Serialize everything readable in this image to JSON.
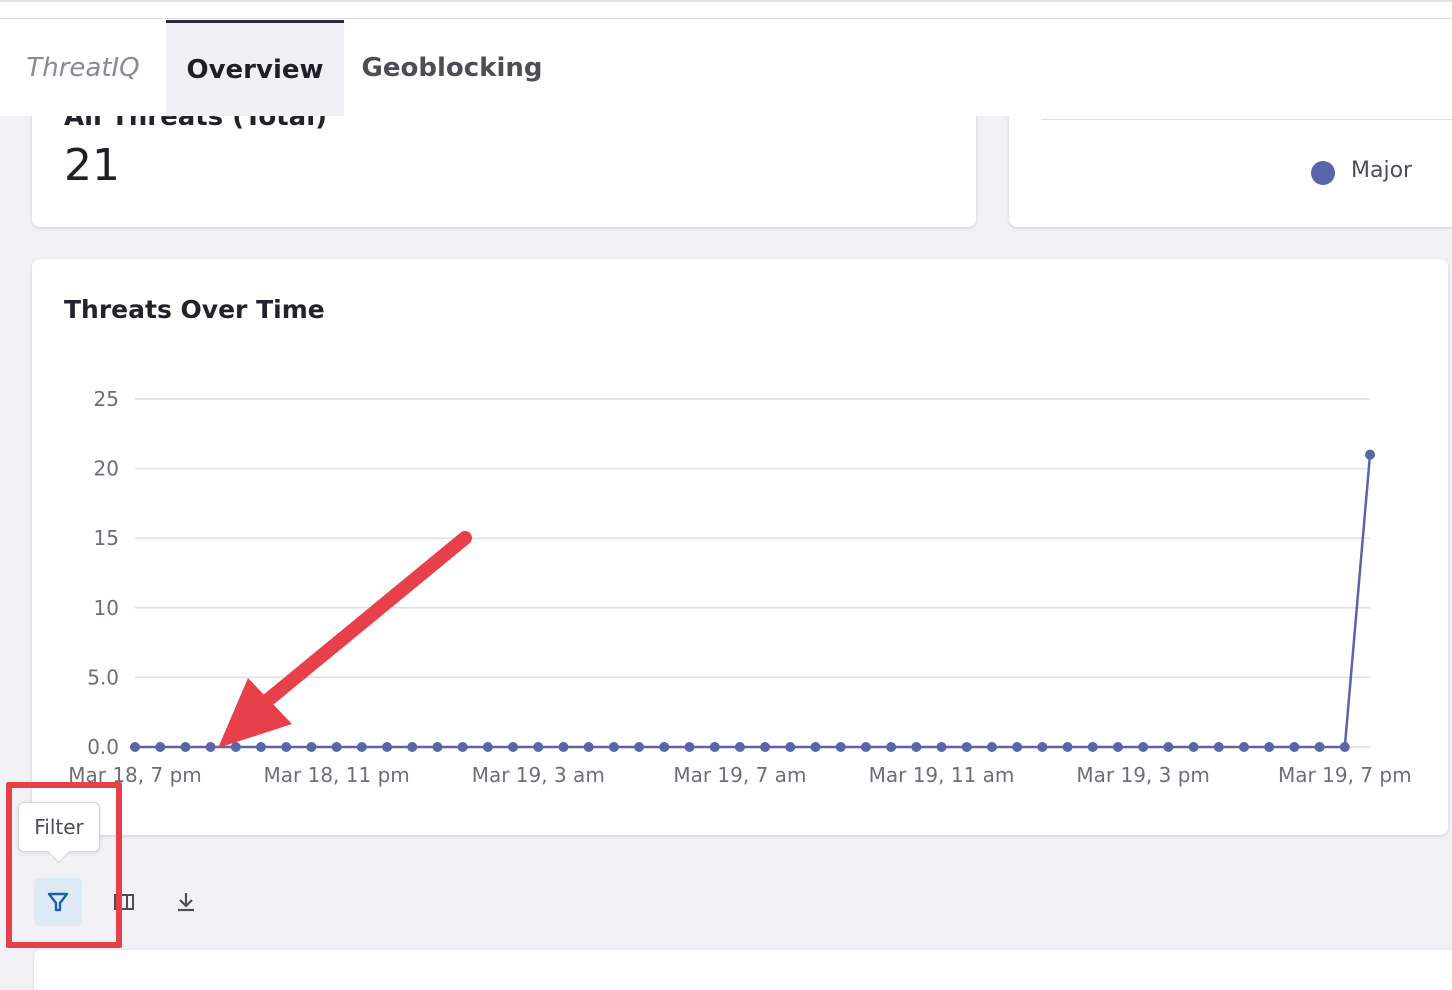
{
  "tabs": {
    "brand": "ThreatIQ",
    "overview": "Overview",
    "geoblocking": "Geoblocking"
  },
  "summary": {
    "label": "All Threats (Total)",
    "value": "21"
  },
  "legend": {
    "item": "Major",
    "color": "#5a64a8"
  },
  "chart": {
    "title": "Threats Over Time"
  },
  "toolbar": {
    "tooltip": "Filter"
  },
  "colors": {
    "series": "#5a64a8",
    "annotation": "#e8404a"
  },
  "chart_data": {
    "type": "line",
    "title": "Threats Over Time",
    "xlabel": "",
    "ylabel": "",
    "ylim": [
      0,
      25
    ],
    "yticks": [
      "0.0",
      "5.0",
      "10",
      "15",
      "20",
      "25"
    ],
    "xtick_labels": [
      "Mar 18, 7 pm",
      "Mar 18, 11 pm",
      "Mar 19, 3 am",
      "Mar 19, 7 am",
      "Mar 19, 11 am",
      "Mar 19, 3 pm",
      "Mar 19, 7 pm"
    ],
    "grid": true,
    "legend": "top-right",
    "series": [
      {
        "name": "Major",
        "values": [
          0,
          0,
          0,
          0,
          0,
          0,
          0,
          0,
          0,
          0,
          0,
          0,
          0,
          0,
          0,
          0,
          0,
          0,
          0,
          0,
          0,
          0,
          0,
          0,
          0,
          0,
          0,
          0,
          0,
          0,
          0,
          0,
          0,
          0,
          0,
          0,
          0,
          0,
          0,
          0,
          0,
          0,
          0,
          0,
          0,
          0,
          0,
          0,
          0,
          21
        ]
      }
    ]
  }
}
